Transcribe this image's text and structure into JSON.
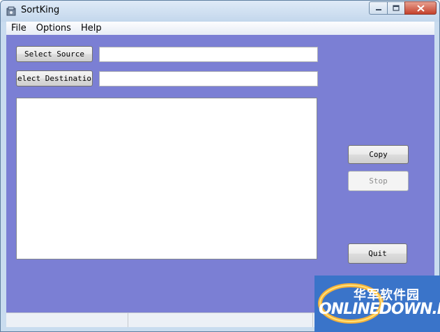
{
  "window": {
    "title": "SortKing"
  },
  "menu": {
    "items": [
      {
        "label": "File"
      },
      {
        "label": "Options"
      },
      {
        "label": "Help"
      }
    ]
  },
  "buttons": {
    "select_source": "Select Source",
    "select_destination": "Select Destination",
    "copy": "Copy",
    "stop": "Stop",
    "quit": "Quit"
  },
  "fields": {
    "source_path": "",
    "destination_path": ""
  },
  "watermark": {
    "cn": "华军软件园",
    "en": "ONLINEDOWN.NET"
  },
  "colors": {
    "client_background": "#7b7fd4",
    "watermark_background": "#3a74c9",
    "close_button": "#c4412b"
  }
}
